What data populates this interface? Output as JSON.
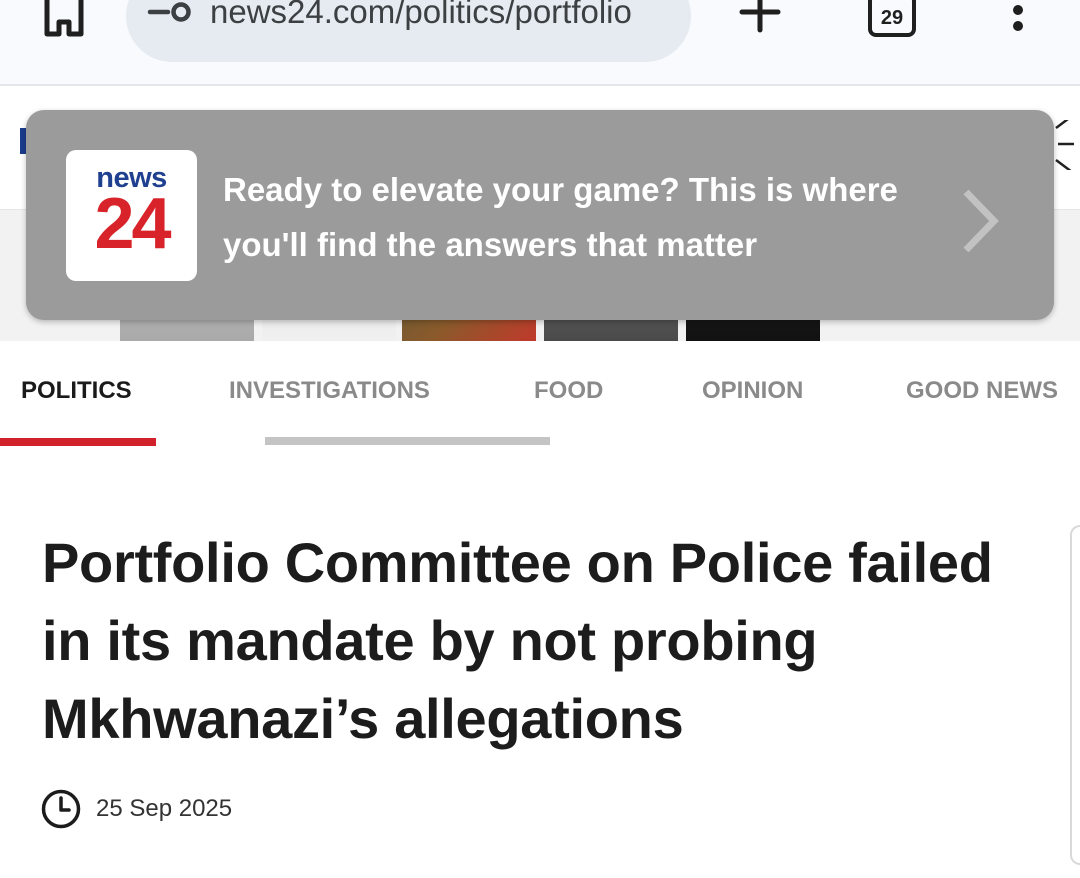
{
  "browser": {
    "url": "news24.com/politics/portfolio",
    "tab_count": "29"
  },
  "popup": {
    "logo_top": "news",
    "logo_bottom": "24",
    "message": "Ready to elevate your game? This is where you'll find the answers that matter"
  },
  "categories": [
    "POLITICS",
    "INVESTIGATIONS",
    "FOOD",
    "OPINION",
    "GOOD NEWS"
  ],
  "active_category": "POLITICS",
  "article": {
    "headline": "Portfolio Committee on Police failed in its mandate by not probing Mkhwanazi’s allegations",
    "date": "25 Sep 2025"
  },
  "colors": {
    "brand_red": "#d1212a",
    "brand_blue": "#1f3f8f",
    "popup_bg": "#9b9b9b"
  }
}
